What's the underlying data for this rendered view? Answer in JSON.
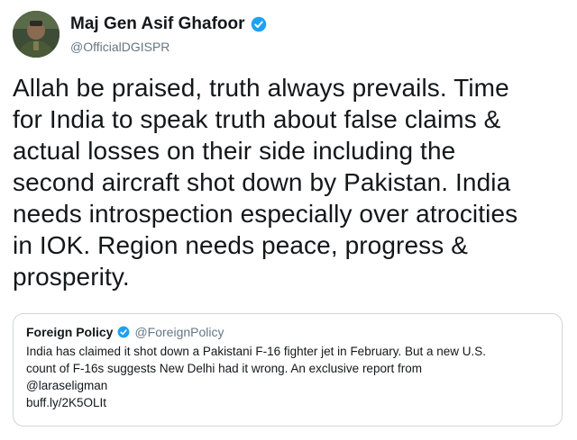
{
  "author": {
    "display_name": "Maj Gen Asif Ghafoor",
    "handle": "@OfficialDGISPR",
    "verified": true
  },
  "tweet": {
    "lines": [
      "Allah be praised, truth always prevails. Time",
      "for India to speak truth about false claims &",
      "actual losses on their side including the",
      "second aircraft shot down by Pakistan. India",
      "needs introspection especially over atrocities",
      "in IOK. Region needs peace, progress &",
      "prosperity."
    ]
  },
  "quoted_tweet": {
    "display_name": "Foreign Policy",
    "handle": "@ForeignPolicy",
    "verified": true,
    "lines": [
      "India has claimed it shot down a Pakistani F-16 fighter jet in February. But a new U.S.",
      "count of F-16s suggests New Delhi had it wrong. An exclusive report from",
      "@laraseligman",
      "buff.ly/2K5OLIt"
    ]
  },
  "colors": {
    "verified_blue": "#1da1f2",
    "text": "#14171a",
    "secondary": "#657786",
    "border": "#ccd6dd"
  },
  "icons": {
    "verified": "verified-badge-icon"
  }
}
